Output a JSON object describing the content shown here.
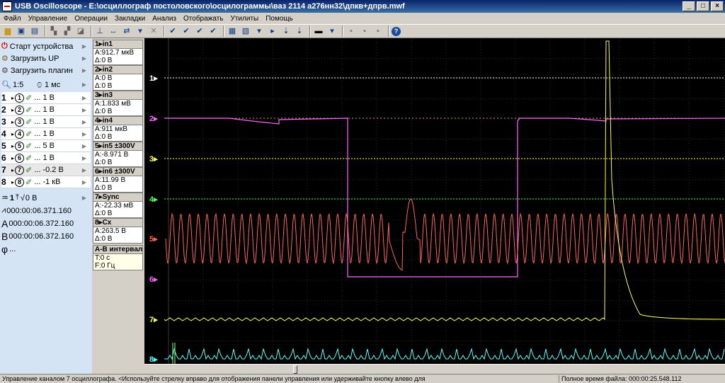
{
  "window": {
    "title": "USB Oscilloscope - E:\\осциллограф постоловского\\осцилограммы\\ваз 2114 а276нн32\\дпкв+дпрв.mwf"
  },
  "menu": [
    "Файл",
    "Управление",
    "Операции",
    "Закладки",
    "Анализ",
    "Отображать",
    "Утилиты",
    "Помощь"
  ],
  "left": {
    "start": "Старт устройства",
    "load_up": "Загрузить UP",
    "load_plugin": "Загрузить плагин",
    "zoom": "1:5",
    "timebase": "1 мс",
    "channels": [
      {
        "n": "1",
        "c": "1",
        "v": "... 1 В"
      },
      {
        "n": "2",
        "c": "2",
        "v": "... 1 В"
      },
      {
        "n": "3",
        "c": "3",
        "v": "... 1 В"
      },
      {
        "n": "4",
        "c": "4",
        "v": "... 1 В"
      },
      {
        "n": "5",
        "c": "5",
        "v": "... 5 В"
      },
      {
        "n": "6",
        "c": "6",
        "v": "... 1 В"
      },
      {
        "n": "7",
        "c": "7",
        "v": "... -0.2 В"
      },
      {
        "n": "8",
        "c": "8",
        "v": "... -1 кВ"
      }
    ],
    "trig_ch": "1",
    "trig_level": "0 В",
    "time_t": "000:00:06.371.160",
    "time_a": "000:00:06.372.160",
    "time_b": "000:00:06.372.160",
    "phi": "..."
  },
  "info": [
    {
      "h": "1▸in1",
      "a": "A:912.7 мкВ",
      "d": "Δ:0 В"
    },
    {
      "h": "2▸in2",
      "a": "A:0 В",
      "d": "Δ:0 В"
    },
    {
      "h": "3▸in3",
      "a": "A:1.833 мВ",
      "d": "Δ:0 В"
    },
    {
      "h": "4▸in4",
      "a": "A:911 мкВ",
      "d": "Δ:0 В"
    },
    {
      "h": "5▸in5 ±300V",
      "a": "A:-8.971 В",
      "d": "Δ:0 В"
    },
    {
      "h": "6▸in6 ±300V",
      "a": "A:11.99 В",
      "d": "Δ:0 В"
    },
    {
      "h": "7▸Sync",
      "a": "A:-22.33 мВ",
      "d": "Δ:0 В"
    },
    {
      "h": "8▸Cx",
      "a": "A:263.5 В",
      "d": "Δ:0 В"
    },
    {
      "h": "A-B интервал",
      "a": "T:0 с",
      "d": "F:0 Гц"
    }
  ],
  "scope": {
    "labels": [
      "1",
      "2",
      "3",
      "4",
      "5",
      "6",
      "7",
      "8"
    ],
    "colors": [
      "#ffffff",
      "#ff66ff",
      "#ffff55",
      "#55ff55",
      "#ff6655",
      "#ff66ff",
      "#ffff55",
      "#55ffff"
    ]
  },
  "status": {
    "msg": "Управление каналом 7 осциллографа. <Используйте стрелку вправо для отображения панели управления или удерживайте кнопку влево для",
    "total": "Полное время файла: 000:00:25.548.112"
  }
}
